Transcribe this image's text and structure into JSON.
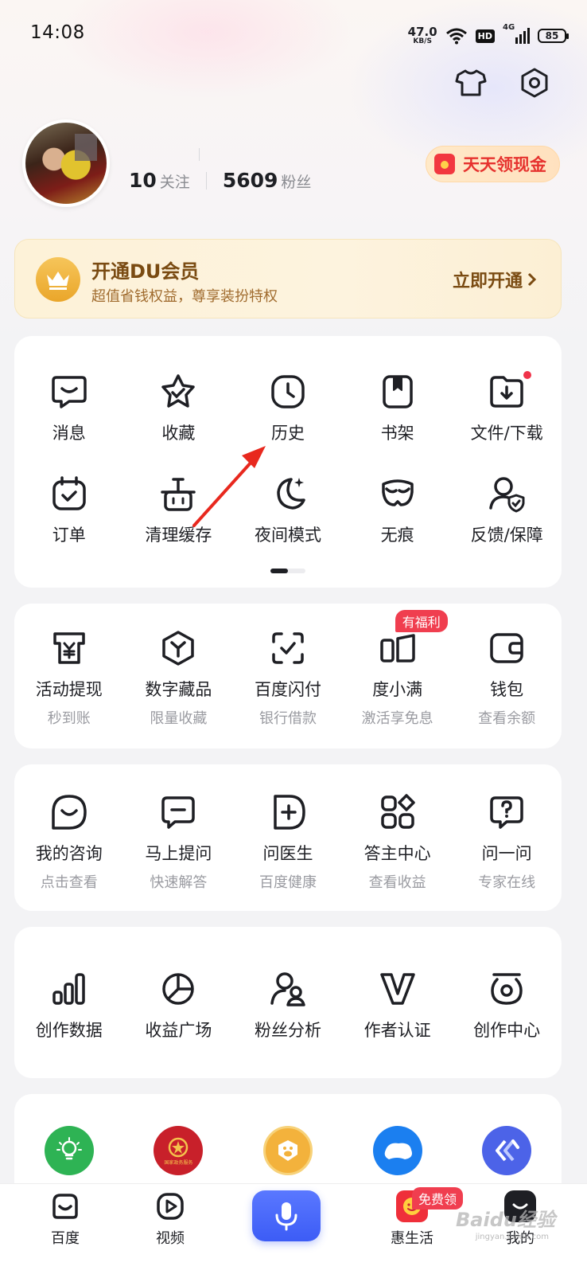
{
  "status_bar": {
    "time": "14:08",
    "net_speed": "47.0",
    "net_unit": "KB/S",
    "hd": "HD",
    "signal": "4G",
    "battery": "85"
  },
  "profile": {
    "follow_count": "10",
    "follow_label": "关注",
    "fans_count": "5609",
    "fans_label": "粉丝",
    "cash_button": "天天领现金"
  },
  "vip": {
    "title": "开通DU会员",
    "subtitle": "超值省钱权益，尊享装扮特权",
    "cta": "立即开通"
  },
  "tools": {
    "row1": [
      "消息",
      "收藏",
      "历史",
      "书架",
      "文件/下载"
    ],
    "row2": [
      "订单",
      "清理缓存",
      "夜间模式",
      "无痕",
      "反馈/保障"
    ]
  },
  "finance": {
    "badge": "有福利",
    "items": [
      {
        "label": "活动提现",
        "sub": "秒到账"
      },
      {
        "label": "数字藏品",
        "sub": "限量收藏"
      },
      {
        "label": "百度闪付",
        "sub": "银行借款"
      },
      {
        "label": "度小满",
        "sub": "激活享免息"
      },
      {
        "label": "钱包",
        "sub": "查看余额"
      }
    ]
  },
  "consult": {
    "items": [
      {
        "label": "我的咨询",
        "sub": "点击查看"
      },
      {
        "label": "马上提问",
        "sub": "快速解答"
      },
      {
        "label": "问医生",
        "sub": "百度健康"
      },
      {
        "label": "答主中心",
        "sub": "查看收益"
      },
      {
        "label": "问一问",
        "sub": "专家在线"
      }
    ]
  },
  "creator": {
    "items": [
      "创作数据",
      "收益广场",
      "粉丝分析",
      "作者认证",
      "创作中心"
    ]
  },
  "apps": {
    "logo2_text": "国家政务服务"
  },
  "bottom_nav": {
    "home": "百度",
    "video": "视频",
    "life": "惠生活",
    "mine": "我的",
    "free_badge": "免费领"
  },
  "watermark": {
    "brand": "Baidu经验",
    "url": "jingyan.baidu.com"
  },
  "colors": {
    "accent": "#3c5cf6",
    "red": "#f03e4f",
    "gold": "#7a4b12"
  }
}
